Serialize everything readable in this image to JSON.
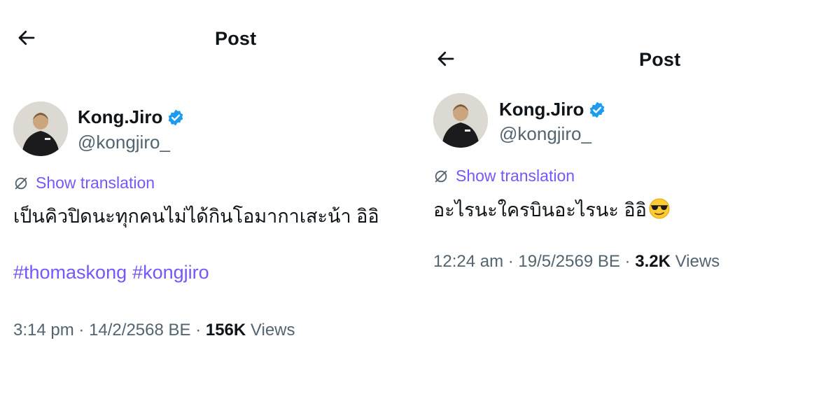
{
  "left": {
    "header": {
      "title": "Post"
    },
    "author": {
      "name": "Kong.Jiro",
      "handle": "@kongjiro_"
    },
    "translation_label": "Show translation",
    "text": "เป็นคิวปิดนะทุกคนไม่ได้กินโอมากาเสะน้า อิอิ",
    "hashtags": [
      "#thomaskong",
      "#kongjiro"
    ],
    "meta": {
      "time": "3:14 pm",
      "sep1": "·",
      "date": "14/2/2568 BE",
      "sep2": "·",
      "views_count": "156K",
      "views_label": "Views"
    }
  },
  "right": {
    "header": {
      "title": "Post"
    },
    "author": {
      "name": "Kong.Jiro",
      "handle": "@kongjiro_"
    },
    "translation_label": "Show translation",
    "text": "อะไรนะใครบินอะไรนะ อิอิ",
    "emoji": "smiling-face-with-sunglasses",
    "meta": {
      "time": "12:24 am",
      "sep1": "·",
      "date": "19/5/2569 BE",
      "sep2": "·",
      "views_count": "3.2K",
      "views_label": "Views"
    }
  },
  "colors": {
    "text_primary": "#0f1419",
    "text_secondary": "#536471",
    "accent": "#7856ff",
    "verified": "#1d9bf0"
  }
}
